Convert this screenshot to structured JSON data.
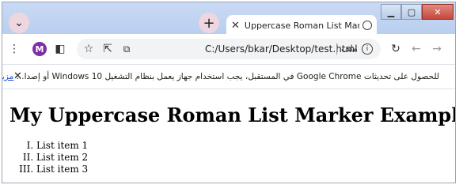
{
  "tab": {
    "title": "Uppercase Roman List Marker Ex"
  },
  "toolbar": {
    "avatar_letter": "M",
    "url": "C:/Users/bkar/Desktop/test.html",
    "file_label": "ملف"
  },
  "infobar": {
    "message": "للحصول على تحديثات Google Chrome في المستقبل، يجب استخدام جهاز يعمل بنظام التشغيل Windows 10 أو إصدا...",
    "link": "مزيد من المعلومات"
  },
  "page": {
    "heading": "My Uppercase Roman List Marker Example",
    "list_items": [
      "List item 1",
      "List item 2",
      "List item 3"
    ]
  },
  "icons": {
    "tab_search": "chevron-down-icon",
    "new_tab": "plus-icon",
    "tab_close": "close-icon",
    "tab_favicon": "globe-icon",
    "menu": "kebab-menu-icon",
    "side_panel": "side-panel-icon",
    "bookmark": "star-icon",
    "share": "share-icon",
    "site_info": "info-icon",
    "reload": "reload-icon",
    "back": "back-arrow-icon",
    "forward": "forward-arrow-icon",
    "infobar_close": "close-icon"
  }
}
